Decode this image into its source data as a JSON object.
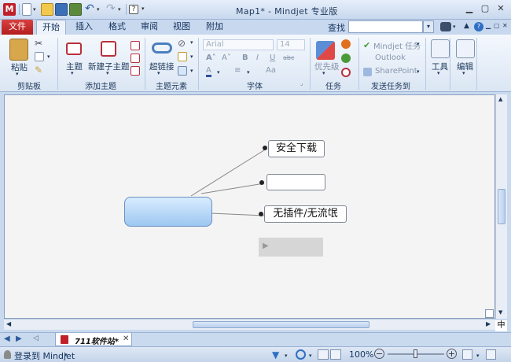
{
  "app": {
    "title": "Map1* - Mindjet 专业版",
    "logo_letter": "M"
  },
  "tabs": {
    "file": "文件",
    "home": "开始",
    "insert": "插入",
    "format": "格式",
    "review": "审阅",
    "view": "视图",
    "addons": "附加"
  },
  "search": {
    "label": "查找",
    "value": ""
  },
  "ribbon": {
    "clipboard": {
      "paste": "粘贴",
      "group": "剪贴板"
    },
    "add_topics": {
      "topic": "主题",
      "subtopic": "新建子主题",
      "group": "添加主题"
    },
    "topic_elements": {
      "hyperlink": "超链接",
      "group": "主题元素"
    },
    "font": {
      "family": "Arial",
      "size": "14",
      "group": "字体"
    },
    "tasks": {
      "priority": "优先级",
      "group": "任务"
    },
    "send_tasks": {
      "mindjet_task": "Mindjet 任务",
      "outlook": "Outlook",
      "sharepoint": "SharePoint",
      "group": "发送任务到"
    },
    "tools": {
      "label": "工具"
    },
    "edit": {
      "label": "编辑"
    }
  },
  "map": {
    "central_topic": "",
    "topics": [
      "安全下载",
      "",
      "无插件/无流氓"
    ],
    "ime_indicator": "中"
  },
  "doc_tab": {
    "label": "711软件站*"
  },
  "status": {
    "login": "登录到 Mindjet",
    "zoom": "100%"
  }
}
